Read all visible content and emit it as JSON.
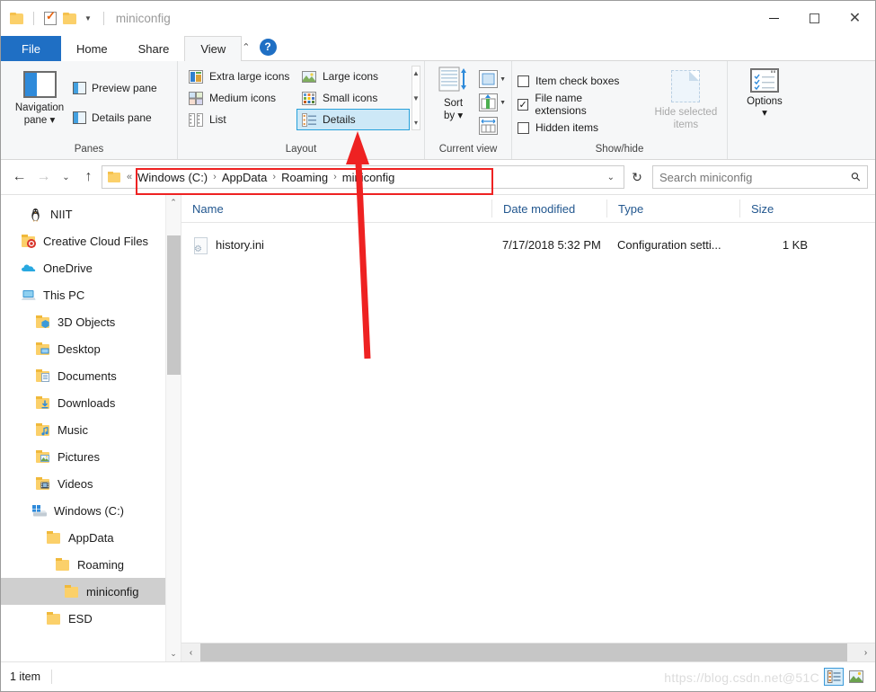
{
  "titlebar": {
    "quick_access": [
      {
        "name": "new-folder",
        "icon": "folder-icon"
      },
      {
        "name": "properties",
        "icon": "properties-icon"
      },
      {
        "name": "new-folder-2",
        "icon": "folder-icon"
      },
      {
        "name": "customize-dropdown",
        "icon": "chevron-down-icon"
      }
    ],
    "title": "miniconfig",
    "minimize": "—",
    "maximize": "□",
    "close": "✕"
  },
  "tabs": [
    {
      "label": "File",
      "active": false,
      "file": true
    },
    {
      "label": "Home",
      "active": false
    },
    {
      "label": "Share",
      "active": false
    },
    {
      "label": "View",
      "active": true
    }
  ],
  "tab_right": {
    "collapse": "⌃",
    "help": "?"
  },
  "ribbon": {
    "groups": [
      {
        "label": "Panes",
        "big_button": "Navigation\npane",
        "big_button_line1": "Navigation",
        "big_button_line2": "pane",
        "items": [
          {
            "label": "Preview pane"
          },
          {
            "label": "Details pane"
          }
        ]
      },
      {
        "label": "Layout",
        "items": [
          {
            "label": "Extra large icons",
            "selected": false
          },
          {
            "label": "Large icons",
            "selected": false
          },
          {
            "label": "Medium icons",
            "selected": false
          },
          {
            "label": "Small icons",
            "selected": false
          },
          {
            "label": "List",
            "selected": false
          },
          {
            "label": "Details",
            "selected": true
          }
        ],
        "scroll": {
          "up": "▲",
          "down": "▼",
          "more": "▼"
        }
      },
      {
        "label": "Current view",
        "sort_by_line1": "Sort",
        "sort_by_line2": "by"
      },
      {
        "label": "Show/hide",
        "checkboxes": [
          {
            "label": "Item check boxes",
            "checked": false
          },
          {
            "label": "File name extensions",
            "checked": true
          },
          {
            "label": "Hidden items",
            "checked": false
          }
        ],
        "hide_selected_line1": "Hide selected",
        "hide_selected_line2": "items"
      },
      {
        "label": "",
        "options_label": "Options",
        "options_caret": "▾"
      }
    ]
  },
  "addressbar": {
    "back": "←",
    "forward": "→",
    "recent": "⌄",
    "up": "↑",
    "overflow": "«",
    "crumbs": [
      "Windows (C:)",
      "AppData",
      "Roaming",
      "miniconfig"
    ],
    "separator": "›",
    "dropdown_caret": "⌄",
    "refresh": "↻",
    "search_placeholder": "Search miniconfig",
    "search_icon": "⚲"
  },
  "sidebar": {
    "items": [
      {
        "label": "NIIT",
        "icon": "penguin-icon",
        "indent": 1,
        "selected": false
      },
      {
        "label": "Creative Cloud Files",
        "icon": "creative-cloud-icon",
        "indent": 0,
        "selected": false
      },
      {
        "label": "OneDrive",
        "icon": "onedrive-icon",
        "indent": 0,
        "selected": false
      },
      {
        "label": "This PC",
        "icon": "computer-icon",
        "indent": 0,
        "selected": false
      },
      {
        "label": "3D Objects",
        "icon": "folder-3d-icon",
        "indent": 1,
        "selected": false
      },
      {
        "label": "Desktop",
        "icon": "folder-desktop-icon",
        "indent": 1,
        "selected": false
      },
      {
        "label": "Documents",
        "icon": "folder-documents-icon",
        "indent": 1,
        "selected": false
      },
      {
        "label": "Downloads",
        "icon": "folder-downloads-icon",
        "indent": 1,
        "selected": false
      },
      {
        "label": "Music",
        "icon": "folder-music-icon",
        "indent": 1,
        "selected": false
      },
      {
        "label": "Pictures",
        "icon": "folder-pictures-icon",
        "indent": 1,
        "selected": false
      },
      {
        "label": "Videos",
        "icon": "folder-videos-icon",
        "indent": 1,
        "selected": false
      },
      {
        "label": "Windows (C:)",
        "icon": "drive-icon",
        "indent": 1,
        "selected": false
      },
      {
        "label": "AppData",
        "icon": "folder-icon",
        "indent": 2,
        "selected": false
      },
      {
        "label": "Roaming",
        "icon": "folder-icon",
        "indent": 3,
        "selected": false
      },
      {
        "label": "miniconfig",
        "icon": "folder-icon",
        "indent": 4,
        "selected": true
      },
      {
        "label": "ESD",
        "icon": "folder-icon",
        "indent": 2,
        "selected": false
      }
    ],
    "scroll_up": "⌃",
    "scroll_down": "⌄"
  },
  "filelist": {
    "columns": [
      "Name",
      "Date modified",
      "Type",
      "Size"
    ],
    "rows": [
      {
        "name": "history.ini",
        "date_modified": "7/17/2018 5:32 PM",
        "type": "Configuration setti...",
        "size": "1 KB",
        "icon": "ini-file-icon"
      }
    ],
    "hscroll_left": "‹",
    "hscroll_right": "›"
  },
  "statusbar": {
    "item_count": "1 item",
    "watermark": "https://blog.csdn.net@51C",
    "view_details_icon": "details-view-icon",
    "view_thumbnails_icon": "thumbnail-view-icon"
  },
  "annotations": {
    "rect_color": "#ee2222",
    "arrow_color": "#ee2222"
  }
}
